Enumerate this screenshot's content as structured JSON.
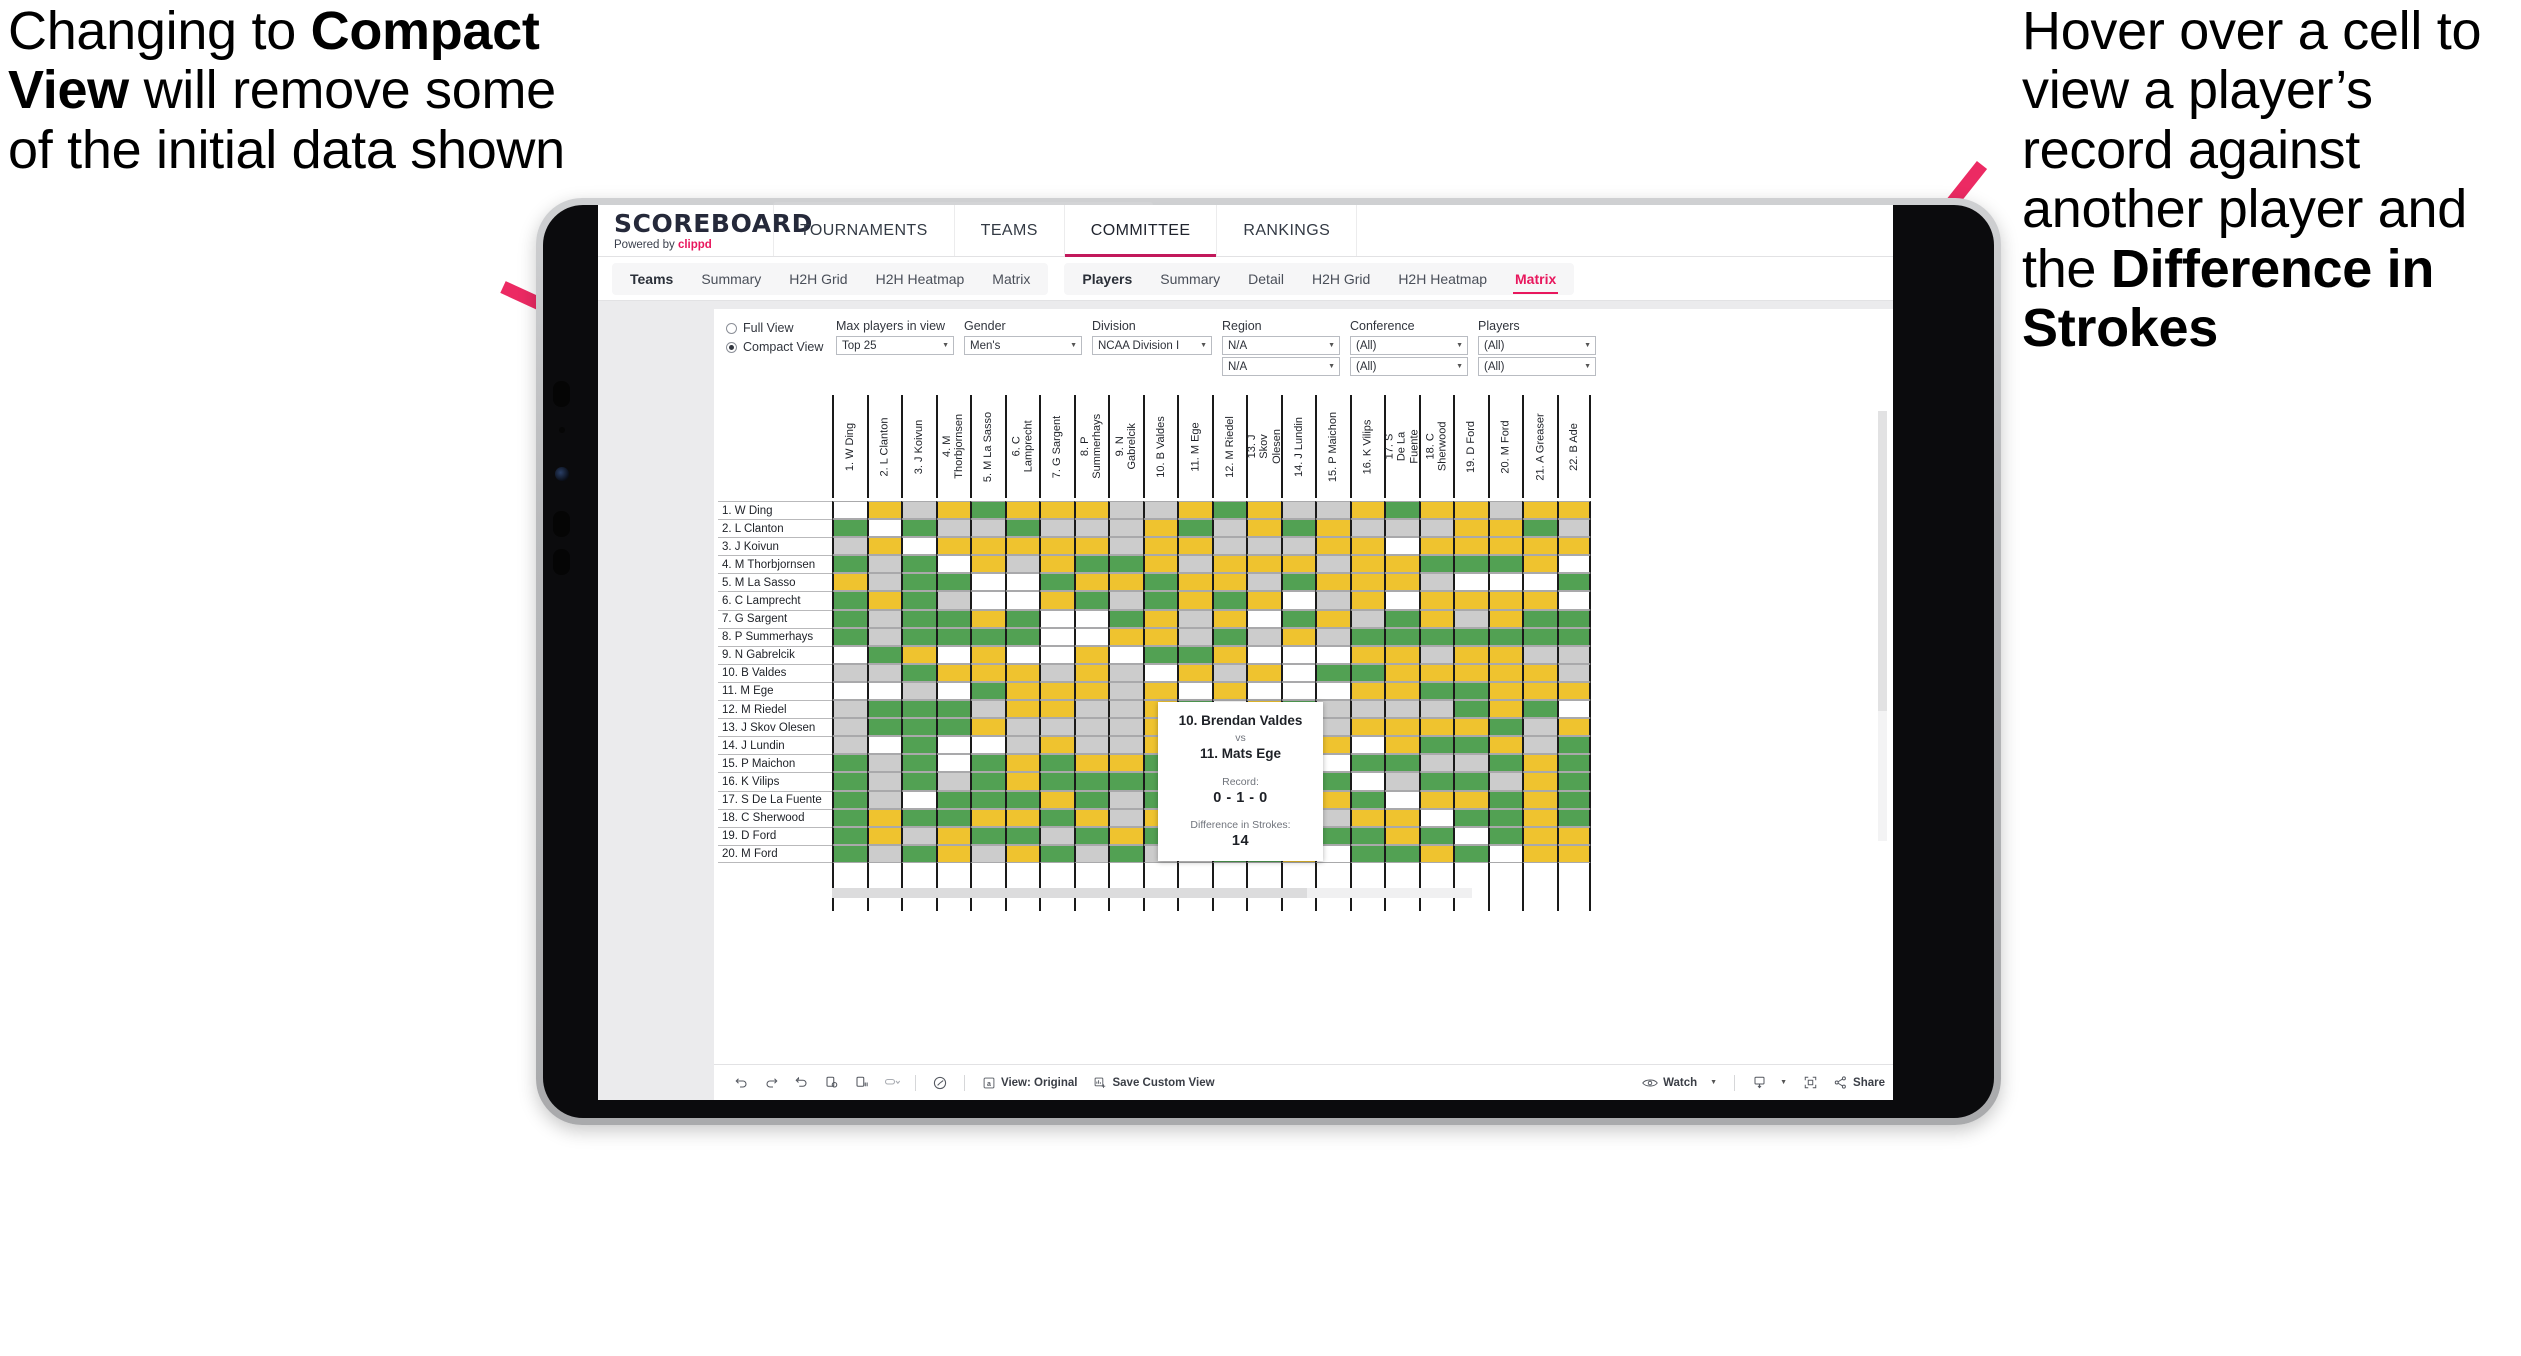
{
  "annotations": {
    "left": {
      "part1": "Changing to ",
      "bold": "Compact View",
      "part2": " will remove some of the initial data shown"
    },
    "right": {
      "part1": "Hover over a cell to view a player’s record against another player and the ",
      "bold": "Difference in Strokes",
      "part2": ""
    }
  },
  "app": {
    "brand": {
      "title": "SCOREBOARD",
      "powered_prefix": "Powered by ",
      "powered_name": "clippd"
    },
    "topnav": [
      {
        "label": "TOURNAMENTS",
        "active": false
      },
      {
        "label": "TEAMS",
        "active": false
      },
      {
        "label": "COMMITTEE",
        "active": true
      },
      {
        "label": "RANKINGS",
        "active": false
      }
    ],
    "subtabs_group1": [
      {
        "label": "Teams",
        "head": true,
        "active": false
      },
      {
        "label": "Summary",
        "head": false,
        "active": false
      },
      {
        "label": "H2H Grid",
        "head": false,
        "active": false
      },
      {
        "label": "H2H Heatmap",
        "head": false,
        "active": false
      },
      {
        "label": "Matrix",
        "head": false,
        "active": false
      }
    ],
    "subtabs_group2": [
      {
        "label": "Players",
        "head": true,
        "active": false
      },
      {
        "label": "Summary",
        "head": false,
        "active": false
      },
      {
        "label": "Detail",
        "head": false,
        "active": false
      },
      {
        "label": "H2H Grid",
        "head": false,
        "active": false
      },
      {
        "label": "H2H Heatmap",
        "head": false,
        "active": false
      },
      {
        "label": "Matrix",
        "head": false,
        "active": true
      }
    ],
    "filters": {
      "view_options": [
        {
          "label": "Full View",
          "selected": false
        },
        {
          "label": "Compact View",
          "selected": true
        }
      ],
      "max_players": {
        "label": "Max players in view",
        "value": "Top 25"
      },
      "gender": {
        "label": "Gender",
        "value": "Men's"
      },
      "division": {
        "label": "Division",
        "value": "NCAA Division I"
      },
      "region": {
        "label": "Region",
        "value": "N/A",
        "value2": "N/A"
      },
      "conference": {
        "label": "Conference",
        "value": "(All)",
        "value2": "(All)"
      },
      "players": {
        "label": "Players",
        "value": "(All)",
        "value2": "(All)"
      }
    },
    "bottombar": {
      "icons": [
        "undo-icon",
        "redo-icon",
        "revert-icon",
        "refresh-data-icon",
        "pause-updates-icon",
        "alert-icon"
      ],
      "view_original": "View: Original",
      "save_custom_view": "Save Custom View",
      "watch": "Watch",
      "share": "Share"
    }
  },
  "tooltip": {
    "player_a": "10. Brendan Valdes",
    "vs": "vs",
    "player_b": "11. Mats Ege",
    "record_label": "Record:",
    "record_value": "0 - 1 - 0",
    "diff_label": "Difference in Strokes:",
    "diff_value": "14"
  },
  "chart_data": {
    "type": "heatmap",
    "title": "Player Head-to-Head Matrix",
    "legend": {
      "green": "#52a153",
      "yellow": "#efc32f",
      "grey": "#cccccc",
      "white": "#ffffff"
    },
    "rows": [
      "1. W Ding",
      "2. L Clanton",
      "3. J Koivun",
      "4. M Thorbjornsen",
      "5. M La Sasso",
      "6. C Lamprecht",
      "7. G Sargent",
      "8. P Summerhays",
      "9. N Gabrelcik",
      "10. B Valdes",
      "11. M Ege",
      "12. M Riedel",
      "13. J Skov Olesen",
      "14. J Lundin",
      "15. P Maichon",
      "16. K Vilips",
      "17. S De La Fuente",
      "18. C Sherwood",
      "19. D Ford",
      "20. M Ford"
    ],
    "columns": [
      "1. W Ding",
      "2. L Clanton",
      "3. J Koivun",
      "4. M Thorbjornsen",
      "5. M La Sasso",
      "6. C Lamprecht",
      "7. G Sargent",
      "8. P Summerhays",
      "9. N Gabrelcik",
      "10. B Valdes",
      "11. M Ege",
      "12. M Riedel",
      "13. J Skov Olesen",
      "14. J Lundin",
      "15. P Maichon",
      "16. K Vilips",
      "17. S De La Fuente",
      "18. C Sherwood",
      "19. D Ford",
      "20. M Ford",
      "21. A Greaser",
      "22. B Ade"
    ],
    "cells": [
      [
        "w",
        "y",
        "a",
        "y",
        "g",
        "y",
        "y",
        "y",
        "a",
        "a",
        "y",
        "g",
        "y",
        "a",
        "a",
        "y",
        "g",
        "y",
        "y",
        "a",
        "y",
        "y"
      ],
      [
        "g",
        "w",
        "g",
        "a",
        "a",
        "g",
        "a",
        "a",
        "a",
        "y",
        "g",
        "a",
        "y",
        "g",
        "y",
        "a",
        "a",
        "a",
        "y",
        "y",
        "g",
        "a"
      ],
      [
        "a",
        "y",
        "w",
        "y",
        "y",
        "y",
        "y",
        "y",
        "a",
        "y",
        "y",
        "a",
        "a",
        "a",
        "y",
        "y",
        "w",
        "y",
        "y",
        "y",
        "y",
        "y"
      ],
      [
        "g",
        "a",
        "g",
        "w",
        "y",
        "a",
        "y",
        "g",
        "g",
        "y",
        "a",
        "y",
        "y",
        "y",
        "a",
        "y",
        "y",
        "g",
        "g",
        "g",
        "y",
        "w"
      ],
      [
        "y",
        "a",
        "g",
        "g",
        "w",
        "w",
        "g",
        "y",
        "y",
        "g",
        "y",
        "y",
        "a",
        "g",
        "y",
        "y",
        "y",
        "a",
        "w",
        "w",
        "w",
        "g"
      ],
      [
        "g",
        "y",
        "g",
        "a",
        "w",
        "w",
        "y",
        "g",
        "a",
        "g",
        "y",
        "g",
        "y",
        "w",
        "a",
        "y",
        "w",
        "y",
        "y",
        "y",
        "y",
        "w"
      ],
      [
        "g",
        "a",
        "g",
        "g",
        "y",
        "g",
        "w",
        "w",
        "g",
        "y",
        "a",
        "y",
        "w",
        "g",
        "y",
        "a",
        "g",
        "y",
        "a",
        "y",
        "g",
        "g"
      ],
      [
        "g",
        "a",
        "g",
        "g",
        "g",
        "g",
        "w",
        "w",
        "y",
        "y",
        "a",
        "g",
        "a",
        "y",
        "a",
        "g",
        "g",
        "g",
        "g",
        "g",
        "g",
        "g"
      ],
      [
        "w",
        "g",
        "y",
        "w",
        "y",
        "w",
        "w",
        "y",
        "w",
        "g",
        "g",
        "y",
        "w",
        "w",
        "w",
        "y",
        "y",
        "a",
        "y",
        "y",
        "a",
        "a"
      ],
      [
        "a",
        "a",
        "g",
        "y",
        "y",
        "y",
        "a",
        "y",
        "a",
        "w",
        "y",
        "a",
        "y",
        "w",
        "g",
        "g",
        "y",
        "y",
        "y",
        "y",
        "y",
        "a"
      ],
      [
        "w",
        "w",
        "a",
        "w",
        "g",
        "y",
        "y",
        "y",
        "a",
        "y",
        "w",
        "y",
        "w",
        "w",
        "w",
        "y",
        "y",
        "g",
        "g",
        "y",
        "y",
        "y"
      ],
      [
        "a",
        "g",
        "g",
        "g",
        "a",
        "y",
        "y",
        "a",
        "a",
        "y",
        "g",
        "w",
        "y",
        "g",
        "a",
        "a",
        "a",
        "a",
        "g",
        "y",
        "g",
        "w"
      ],
      [
        "a",
        "g",
        "g",
        "g",
        "y",
        "a",
        "a",
        "a",
        "a",
        "y",
        "y",
        "y",
        "w",
        "y",
        "a",
        "y",
        "y",
        "y",
        "y",
        "g",
        "a",
        "y"
      ],
      [
        "a",
        "w",
        "g",
        "w",
        "w",
        "a",
        "y",
        "a",
        "a",
        "y",
        "y",
        "y",
        "g",
        "w",
        "y",
        "w",
        "y",
        "g",
        "g",
        "y",
        "a",
        "g"
      ],
      [
        "g",
        "a",
        "g",
        "w",
        "g",
        "y",
        "g",
        "y",
        "y",
        "g",
        "y",
        "a",
        "g",
        "g",
        "w",
        "g",
        "g",
        "a",
        "a",
        "g",
        "y",
        "g"
      ],
      [
        "g",
        "a",
        "g",
        "a",
        "g",
        "y",
        "g",
        "g",
        "g",
        "g",
        "w",
        "a",
        "g",
        "g",
        "g",
        "w",
        "a",
        "g",
        "g",
        "a",
        "y",
        "g"
      ],
      [
        "g",
        "a",
        "w",
        "g",
        "g",
        "g",
        "y",
        "g",
        "a",
        "g",
        "y",
        "y",
        "y",
        "a",
        "y",
        "g",
        "w",
        "y",
        "y",
        "g",
        "y",
        "g"
      ],
      [
        "g",
        "y",
        "g",
        "g",
        "y",
        "y",
        "g",
        "y",
        "a",
        "y",
        "y",
        "g",
        "g",
        "y",
        "a",
        "y",
        "y",
        "w",
        "g",
        "g",
        "y",
        "g"
      ],
      [
        "g",
        "y",
        "a",
        "y",
        "g",
        "g",
        "a",
        "g",
        "y",
        "g",
        "a",
        "g",
        "g",
        "w",
        "g",
        "g",
        "y",
        "g",
        "w",
        "g",
        "y",
        "y"
      ],
      [
        "g",
        "a",
        "g",
        "y",
        "a",
        "y",
        "g",
        "a",
        "g",
        "a",
        "a",
        "g",
        "g",
        "y",
        "w",
        "g",
        "g",
        "y",
        "g",
        "w",
        "y",
        "y"
      ]
    ]
  }
}
